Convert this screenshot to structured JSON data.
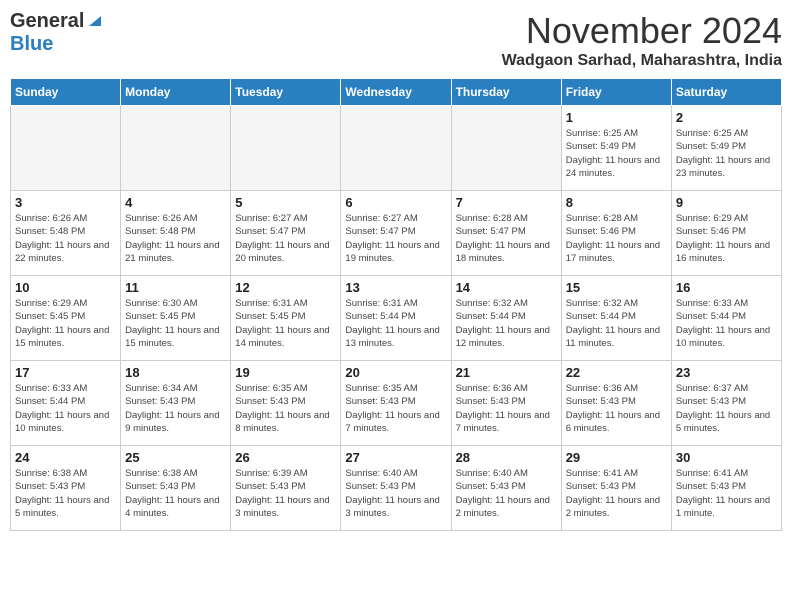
{
  "header": {
    "logo_general": "General",
    "logo_blue": "Blue",
    "month": "November 2024",
    "location": "Wadgaon Sarhad, Maharashtra, India"
  },
  "days_of_week": [
    "Sunday",
    "Monday",
    "Tuesday",
    "Wednesday",
    "Thursday",
    "Friday",
    "Saturday"
  ],
  "weeks": [
    [
      {
        "day": "",
        "info": ""
      },
      {
        "day": "",
        "info": ""
      },
      {
        "day": "",
        "info": ""
      },
      {
        "day": "",
        "info": ""
      },
      {
        "day": "",
        "info": ""
      },
      {
        "day": "1",
        "info": "Sunrise: 6:25 AM\nSunset: 5:49 PM\nDaylight: 11 hours and 24 minutes."
      },
      {
        "day": "2",
        "info": "Sunrise: 6:25 AM\nSunset: 5:49 PM\nDaylight: 11 hours and 23 minutes."
      }
    ],
    [
      {
        "day": "3",
        "info": "Sunrise: 6:26 AM\nSunset: 5:48 PM\nDaylight: 11 hours and 22 minutes."
      },
      {
        "day": "4",
        "info": "Sunrise: 6:26 AM\nSunset: 5:48 PM\nDaylight: 11 hours and 21 minutes."
      },
      {
        "day": "5",
        "info": "Sunrise: 6:27 AM\nSunset: 5:47 PM\nDaylight: 11 hours and 20 minutes."
      },
      {
        "day": "6",
        "info": "Sunrise: 6:27 AM\nSunset: 5:47 PM\nDaylight: 11 hours and 19 minutes."
      },
      {
        "day": "7",
        "info": "Sunrise: 6:28 AM\nSunset: 5:47 PM\nDaylight: 11 hours and 18 minutes."
      },
      {
        "day": "8",
        "info": "Sunrise: 6:28 AM\nSunset: 5:46 PM\nDaylight: 11 hours and 17 minutes."
      },
      {
        "day": "9",
        "info": "Sunrise: 6:29 AM\nSunset: 5:46 PM\nDaylight: 11 hours and 16 minutes."
      }
    ],
    [
      {
        "day": "10",
        "info": "Sunrise: 6:29 AM\nSunset: 5:45 PM\nDaylight: 11 hours and 15 minutes."
      },
      {
        "day": "11",
        "info": "Sunrise: 6:30 AM\nSunset: 5:45 PM\nDaylight: 11 hours and 15 minutes."
      },
      {
        "day": "12",
        "info": "Sunrise: 6:31 AM\nSunset: 5:45 PM\nDaylight: 11 hours and 14 minutes."
      },
      {
        "day": "13",
        "info": "Sunrise: 6:31 AM\nSunset: 5:44 PM\nDaylight: 11 hours and 13 minutes."
      },
      {
        "day": "14",
        "info": "Sunrise: 6:32 AM\nSunset: 5:44 PM\nDaylight: 11 hours and 12 minutes."
      },
      {
        "day": "15",
        "info": "Sunrise: 6:32 AM\nSunset: 5:44 PM\nDaylight: 11 hours and 11 minutes."
      },
      {
        "day": "16",
        "info": "Sunrise: 6:33 AM\nSunset: 5:44 PM\nDaylight: 11 hours and 10 minutes."
      }
    ],
    [
      {
        "day": "17",
        "info": "Sunrise: 6:33 AM\nSunset: 5:44 PM\nDaylight: 11 hours and 10 minutes."
      },
      {
        "day": "18",
        "info": "Sunrise: 6:34 AM\nSunset: 5:43 PM\nDaylight: 11 hours and 9 minutes."
      },
      {
        "day": "19",
        "info": "Sunrise: 6:35 AM\nSunset: 5:43 PM\nDaylight: 11 hours and 8 minutes."
      },
      {
        "day": "20",
        "info": "Sunrise: 6:35 AM\nSunset: 5:43 PM\nDaylight: 11 hours and 7 minutes."
      },
      {
        "day": "21",
        "info": "Sunrise: 6:36 AM\nSunset: 5:43 PM\nDaylight: 11 hours and 7 minutes."
      },
      {
        "day": "22",
        "info": "Sunrise: 6:36 AM\nSunset: 5:43 PM\nDaylight: 11 hours and 6 minutes."
      },
      {
        "day": "23",
        "info": "Sunrise: 6:37 AM\nSunset: 5:43 PM\nDaylight: 11 hours and 5 minutes."
      }
    ],
    [
      {
        "day": "24",
        "info": "Sunrise: 6:38 AM\nSunset: 5:43 PM\nDaylight: 11 hours and 5 minutes."
      },
      {
        "day": "25",
        "info": "Sunrise: 6:38 AM\nSunset: 5:43 PM\nDaylight: 11 hours and 4 minutes."
      },
      {
        "day": "26",
        "info": "Sunrise: 6:39 AM\nSunset: 5:43 PM\nDaylight: 11 hours and 3 minutes."
      },
      {
        "day": "27",
        "info": "Sunrise: 6:40 AM\nSunset: 5:43 PM\nDaylight: 11 hours and 3 minutes."
      },
      {
        "day": "28",
        "info": "Sunrise: 6:40 AM\nSunset: 5:43 PM\nDaylight: 11 hours and 2 minutes."
      },
      {
        "day": "29",
        "info": "Sunrise: 6:41 AM\nSunset: 5:43 PM\nDaylight: 11 hours and 2 minutes."
      },
      {
        "day": "30",
        "info": "Sunrise: 6:41 AM\nSunset: 5:43 PM\nDaylight: 11 hours and 1 minute."
      }
    ]
  ]
}
